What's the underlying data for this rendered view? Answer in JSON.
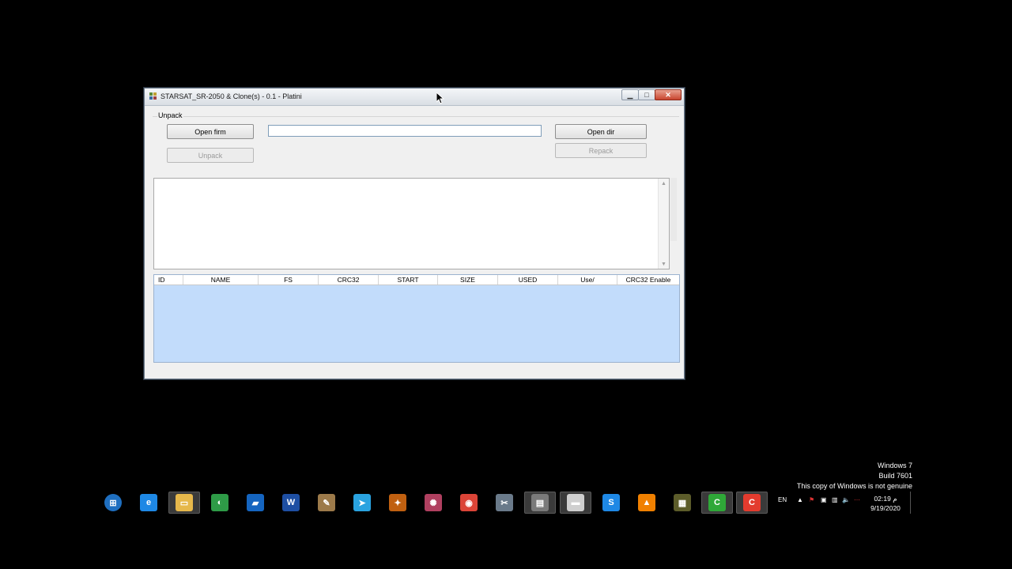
{
  "window": {
    "title": "STARSAT_SR-2050 & Clone(s) - 0.1 - Platini",
    "group_label": "Unpack",
    "buttons": {
      "open_firm": "Open firm",
      "unpack": "Unpack",
      "open_dir": "Open dir",
      "repack": "Repack"
    },
    "path_value": "",
    "table_headers": [
      "ID",
      "NAME",
      "FS",
      "CRC32",
      "START",
      "SIZE",
      "USED",
      "Use/",
      "CRC32 Enable"
    ]
  },
  "watermark": {
    "line1": "Windows 7",
    "line2": "Build 7601",
    "line3": "This copy of Windows is not genuine"
  },
  "taskbar": {
    "apps": [
      {
        "icon": "windows-start-icon",
        "color": "#1f6fc0",
        "glyph": "⊞"
      },
      {
        "icon": "internet-explorer-icon",
        "color": "#1e88e5",
        "glyph": "e"
      },
      {
        "icon": "file-explorer-icon",
        "color": "#e6b84b",
        "glyph": "▭"
      },
      {
        "icon": "globe-app-icon",
        "color": "#2e9b47",
        "glyph": "◐"
      },
      {
        "icon": "scanner-app-icon",
        "color": "#1565c0",
        "glyph": "▰"
      },
      {
        "icon": "word-icon",
        "color": "#1e4fa3",
        "glyph": "W"
      },
      {
        "icon": "paint-icon",
        "color": "#9c7a4a",
        "glyph": "✎"
      },
      {
        "icon": "telegram-icon",
        "color": "#2aa3e0",
        "glyph": "➤"
      },
      {
        "icon": "tool-app-icon",
        "color": "#c06010",
        "glyph": "✦"
      },
      {
        "icon": "satellite-app-icon",
        "color": "#b04060",
        "glyph": "✺"
      },
      {
        "icon": "chrome-icon",
        "color": "#db4437",
        "glyph": "◉"
      },
      {
        "icon": "tools-icon",
        "color": "#6a7a8a",
        "glyph": "✂"
      },
      {
        "icon": "firmware-tool-icon",
        "color": "#7a7a7a",
        "glyph": "▤"
      },
      {
        "icon": "document-icon",
        "color": "#cfcfcf",
        "glyph": "▬"
      },
      {
        "icon": "sync-app-icon",
        "color": "#1e88e5",
        "glyph": "S"
      },
      {
        "icon": "vlc-icon",
        "color": "#f08000",
        "glyph": "▲"
      },
      {
        "icon": "chip-icon",
        "color": "#5c5c2a",
        "glyph": "▦"
      },
      {
        "icon": "camtasia-green-icon",
        "color": "#2fa838",
        "glyph": "C"
      },
      {
        "icon": "camtasia-red-icon",
        "color": "#e33b2e",
        "glyph": "C"
      }
    ],
    "language": "EN",
    "time": "02:19 م",
    "date": "9/19/2020"
  }
}
